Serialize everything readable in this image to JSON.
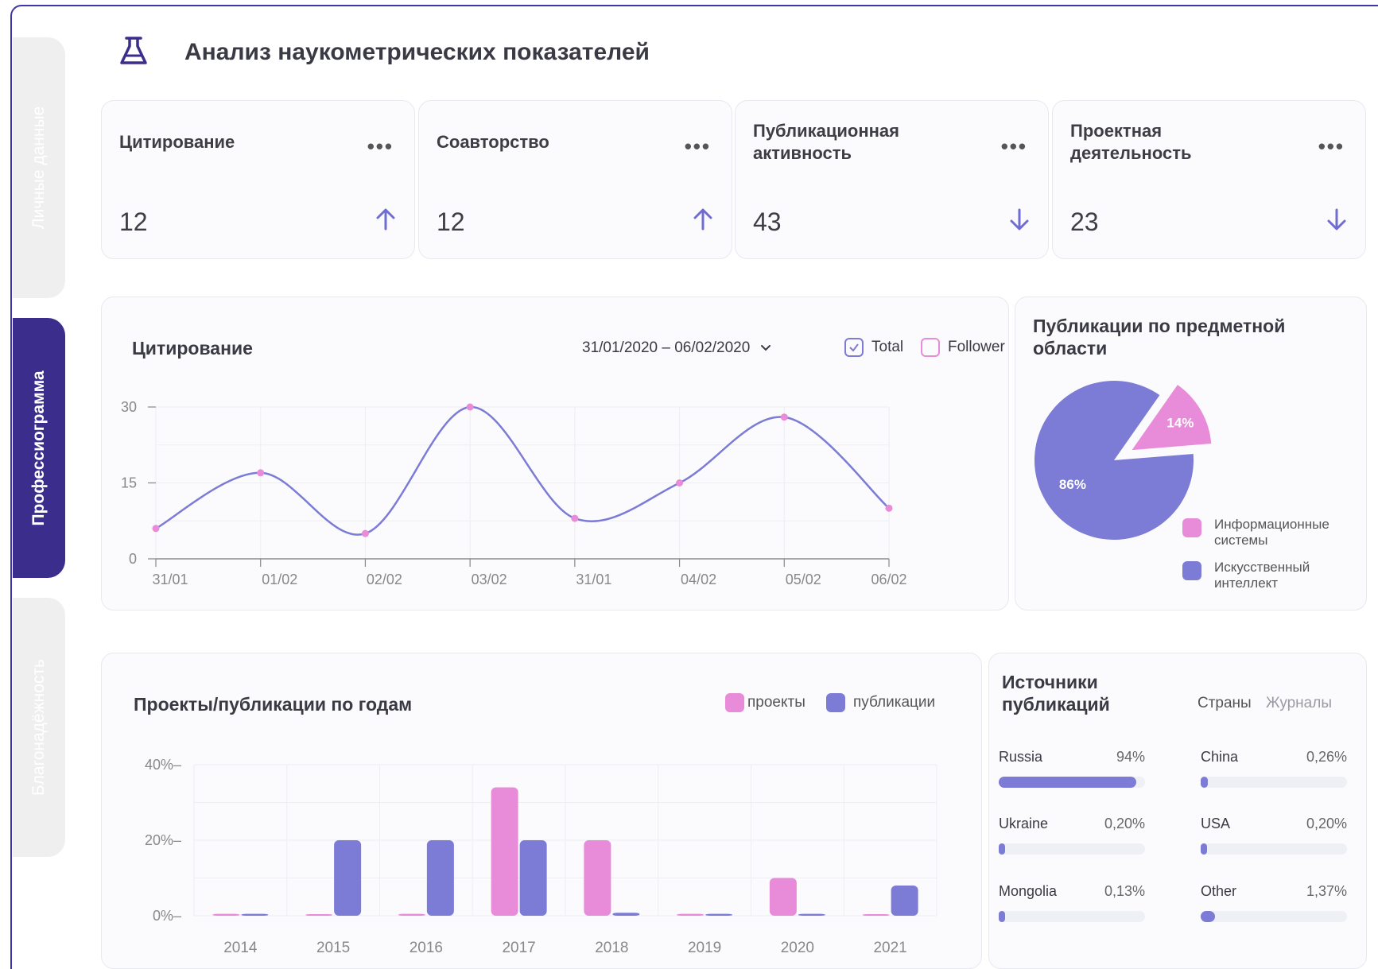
{
  "app": {
    "title": "Анализ наукометрических показателей",
    "accent": "#7c7bd6",
    "pink": "#e88bd8",
    "dark": "#3b2d8c"
  },
  "sidebar": {
    "tabs": [
      {
        "label": "Личные данные",
        "active": false
      },
      {
        "label": "Профессиограмма",
        "active": true
      },
      {
        "label": "Благонадёжность",
        "active": false
      }
    ]
  },
  "kpis": [
    {
      "title": "Цитирование",
      "value": "12",
      "trend": "up",
      "more": "•••"
    },
    {
      "title": "Соавторство",
      "value": "12",
      "trend": "up",
      "more": "•••"
    },
    {
      "title": "Публикационная активность",
      "value": "43",
      "trend": "down",
      "more": "•••"
    },
    {
      "title": "Проектная деятельность",
      "value": "23",
      "trend": "down",
      "more": "•••"
    }
  ],
  "citation": {
    "title": "Цитирование",
    "date_range": "31/01/2020 – 06/02/2020",
    "legend": [
      {
        "label": "Total",
        "checked": true
      },
      {
        "label": "Follower",
        "checked": false
      }
    ]
  },
  "pie": {
    "title": "Публикации по предметной области",
    "legend": [
      {
        "label": "Информационные системы",
        "color": "#e88bd8"
      },
      {
        "label": "Искусственный интеллект",
        "color": "#7c7bd6"
      }
    ]
  },
  "bars": {
    "title": "Проекты/публикации по годам",
    "legend": [
      {
        "label": "проекты",
        "color": "#e88bd8"
      },
      {
        "label": "публикации",
        "color": "#7c7bd6"
      }
    ]
  },
  "sources": {
    "title": "Источники публикаций",
    "tabs": [
      {
        "label": "Страны",
        "active": true
      },
      {
        "label": "Журналы",
        "active": false
      }
    ],
    "items": [
      {
        "name": "Russia",
        "pct": "94%",
        "level": 0.94
      },
      {
        "name": "China",
        "pct": "0,26%",
        "level": 0.05
      },
      {
        "name": "Ukraine",
        "pct": "0,20%",
        "level": 0.03
      },
      {
        "name": "USA",
        "pct": "0,20%",
        "level": 0.03
      },
      {
        "name": "Mongolia",
        "pct": "0,13%",
        "level": 0.02
      },
      {
        "name": "Other",
        "pct": "1,37%",
        "level": 0.1
      }
    ]
  },
  "chart_data": [
    {
      "type": "line",
      "title": "Цитирование",
      "x": [
        "31/01",
        "01/02",
        "02/02",
        "03/02",
        "31/01",
        "04/02",
        "05/02",
        "06/02"
      ],
      "series": [
        {
          "name": "Total",
          "values": [
            6,
            17,
            5,
            30,
            8,
            15,
            28,
            10
          ]
        }
      ],
      "yticks": [
        "0",
        "15",
        "30"
      ],
      "ylim": [
        0,
        30
      ],
      "grid": true
    },
    {
      "type": "pie",
      "title": "Публикации по предметной области",
      "slices": [
        {
          "name": "Информационные системы",
          "value": 14,
          "label": "14%"
        },
        {
          "name": "Искусственный интеллект",
          "value": 86,
          "label": "86%"
        }
      ]
    },
    {
      "type": "bar",
      "title": "Проекты/публикации по годам",
      "categories": [
        "2014",
        "2015",
        "2016",
        "2017",
        "2018",
        "2019",
        "2020",
        "2021"
      ],
      "series": [
        {
          "name": "проекты",
          "values": [
            0.5,
            0.3,
            0.5,
            34,
            20,
            0.5,
            10,
            0.3
          ]
        },
        {
          "name": "публикации",
          "values": [
            0.5,
            20,
            20,
            20,
            0.8,
            0.5,
            0.5,
            8
          ]
        }
      ],
      "yticks": [
        "40%–",
        "20%–",
        "0%–"
      ],
      "ylim": [
        0,
        40
      ],
      "grid": true
    }
  ]
}
